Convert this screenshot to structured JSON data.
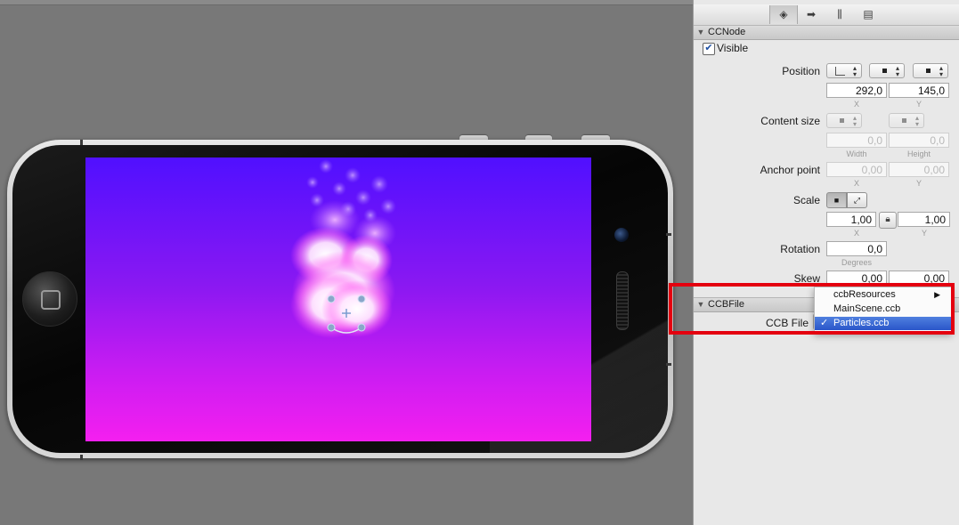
{
  "inspector": {
    "tabs": [
      {
        "icon": "node-properties-icon",
        "glyph": "◈"
      },
      {
        "icon": "arrow-right-circle-icon",
        "glyph": "➡"
      },
      {
        "icon": "sliders-icon",
        "glyph": "⫼"
      },
      {
        "icon": "layers-icon",
        "glyph": "▤"
      }
    ],
    "ccnode": {
      "title": "CCNode",
      "visible_label": "Visible",
      "visible_checked": true,
      "position_label": "Position",
      "position_x": "292,0",
      "position_y": "145,0",
      "x_label": "X",
      "y_label": "Y",
      "content_size_label": "Content size",
      "content_width": "0,0",
      "content_height": "0,0",
      "width_label": "Width",
      "height_label": "Height",
      "anchor_label": "Anchor point",
      "anchor_x": "0,00",
      "anchor_y": "0,00",
      "scale_label": "Scale",
      "scale_x": "1,00",
      "scale_y": "1,00",
      "rotation_label": "Rotation",
      "rotation_value": "0,0",
      "degrees_label": "Degrees",
      "skew_label": "Skew",
      "skew_x": "0,00",
      "skew_y": "0,00"
    },
    "ccbfile": {
      "title": "CCBFile",
      "field_label": "CCB File"
    },
    "dropdown": {
      "items": [
        {
          "label": "ccbResources",
          "has_submenu": true,
          "selected": false
        },
        {
          "label": "MainScene.ccb",
          "has_submenu": false,
          "selected": false
        },
        {
          "label": "Particles.ccb",
          "has_submenu": false,
          "selected": true
        }
      ],
      "check_glyph": "✓",
      "submenu_glyph": "▶"
    }
  },
  "colors": {
    "highlight": "#e4000f",
    "selection": "#2a56c9",
    "screen_top": "#5010ff",
    "screen_bottom": "#f51ff0"
  }
}
